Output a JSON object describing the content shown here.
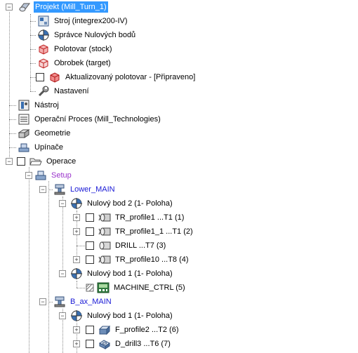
{
  "tree": {
    "root_label": "Projekt (Mill_Turn_1)",
    "stroj": "Stroj (integrex200-IV)",
    "spravce": "Správce Nulových bodů",
    "polotovar": "Polotovar (stock)",
    "obrobek": "Obrobek (target)",
    "aktualizovany": "Aktualizovaný polotovar - [Připraveno]",
    "nastaveni": "Nastavení",
    "nastroj": "Nástroj",
    "operacni_proces": "Operační Proces (Mill_Technologies)",
    "geometrie": "Geometrie",
    "upinace": "Upínače",
    "operace": "Operace",
    "setup": "Setup",
    "lower_main": "Lower_MAIN",
    "nulovy_bod_2": "Nulový bod 2 (1- Poloha)",
    "tr_profile1": "TR_profile1 ...T1 (1)",
    "tr_profile1_1": "TR_profile1_1 ...T1 (2)",
    "drill": "DRILL ...T7 (3)",
    "tr_profile10": "TR_profile10 ...T8 (4)",
    "nulovy_bod_1a": "Nulový bod 1 (1- Poloha)",
    "machine_ctrl": "MACHINE_CTRL (5)",
    "b_ax_main": "B_ax_MAIN",
    "nulovy_bod_1b": "Nulový bod 1 (1- Poloha)",
    "f_profile2": "F_profile2 ...T2 (6)",
    "d_drill3": "D_drill3 ...T6 (7)"
  },
  "colors": {
    "selection": "#3399ff",
    "blue_text": "#1a1ad6",
    "setup_text": "#9a33cc"
  }
}
